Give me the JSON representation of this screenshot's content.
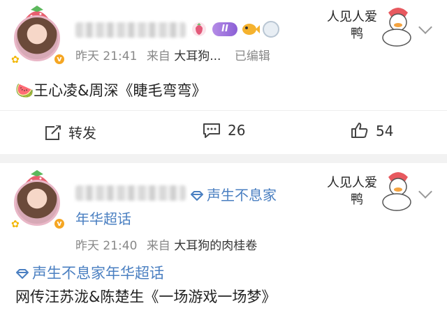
{
  "posts": [
    {
      "time": "昨天 21:41",
      "source_prefix": "来自",
      "source": "大耳狗...",
      "edited": "已编辑",
      "badge": "II",
      "content": "王心凌&周深《睫毛弯弯》",
      "content_emoji": "🍉",
      "sticker_line1": "人见人爱",
      "sticker_line2": "鸭",
      "actions": {
        "repost_label": "转发",
        "comment_count": "26",
        "like_count": "54"
      }
    },
    {
      "topic_line1": "声生不息家",
      "topic_line2": "年华超话",
      "time": "昨天 21:40",
      "source_prefix": "来自",
      "source": "大耳狗的肉桂卷",
      "topic_full": "声生不息家年华超话",
      "content": "网传汪苏泷&陈楚生《一场游戏一场梦》",
      "sticker_line1": "人见人爱",
      "sticker_line2": "鸭"
    }
  ],
  "colors": {
    "link": "#4a7fc1",
    "verify": "#f5a623",
    "badge": "#8b5fd6"
  },
  "icons": [
    "repost-icon",
    "comment-icon",
    "like-icon",
    "topic-diamond-icon",
    "chevron-down-icon"
  ]
}
